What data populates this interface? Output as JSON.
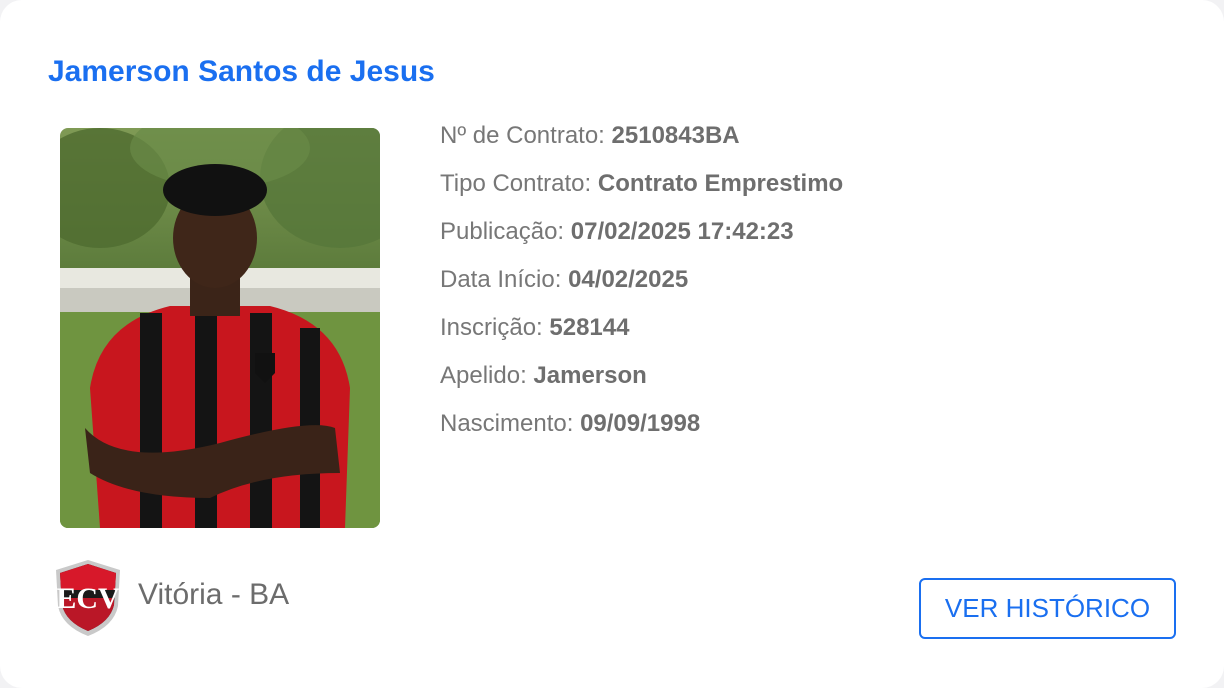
{
  "player": {
    "name": "Jamerson Santos de Jesus"
  },
  "details": [
    {
      "label": "Nº de Contrato:",
      "value": "2510843BA"
    },
    {
      "label": "Tipo Contrato:",
      "value": "Contrato Emprestimo"
    },
    {
      "label": "Publicação:",
      "value": "07/02/2025 17:42:23"
    },
    {
      "label": "Data Início:",
      "value": "04/02/2025"
    },
    {
      "label": "Inscrição:",
      "value": "528144"
    },
    {
      "label": "Apelido:",
      "value": "Jamerson"
    },
    {
      "label": "Nascimento:",
      "value": "09/09/1998"
    }
  ],
  "club": {
    "name": "Vitória - BA",
    "crest_icon": "club-crest-icon"
  },
  "actions": {
    "history_label": "VER HISTÓRICO"
  },
  "colors": {
    "accent": "#1a6ff0",
    "label_text": "#777777",
    "club_red": "#d7182a",
    "club_black": "#1a1a1a"
  }
}
